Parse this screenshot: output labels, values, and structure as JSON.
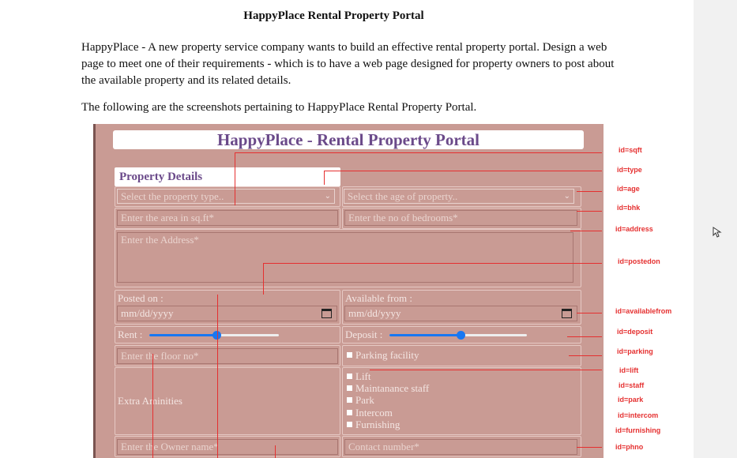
{
  "doc": {
    "title": "HappyPlace Rental Property Portal",
    "paragraph": "HappyPlace - A new property service company wants to build an effective rental property portal. Design a web page to meet one of their requirements - which is to have a web page designed for property owners to post about the available property and its related details.",
    "paragraph2": "The following are the screenshots pertaining to HappyPlace Rental Property Portal."
  },
  "portal": {
    "title": "HappyPlace - Rental Property Portal",
    "section": "Property Details",
    "type_placeholder": "Select the property type..",
    "age_placeholder": "Select the age of property..",
    "sqft_placeholder": "Enter the area in sq.ft*",
    "bhk_placeholder": "Enter the no of bedrooms*",
    "address_placeholder": "Enter the Address*",
    "posted_label": "Posted on :",
    "posted_value": "mm/dd/yyyy",
    "available_label": "Available from :",
    "available_value": "mm/dd/yyyy",
    "rent_label": "Rent :",
    "rent_level": 0.52,
    "deposit_label": "Deposit :",
    "deposit_level": 0.52,
    "floor_placeholder": "Enter the floor no*",
    "parking_label": "Parking facility",
    "amenities_label": "Extra Aminities",
    "amenities": [
      "Lift",
      "Maintanance staff",
      "Park",
      "Intercom",
      "Furnishing"
    ],
    "owner_placeholder": "Enter the Owner name*",
    "contact_placeholder": "Contact number*"
  },
  "annotations": {
    "sqft": "id=sqft",
    "type": "id=type",
    "age": "id=age",
    "bhk": "id=bhk",
    "address": "id=address",
    "postedon": "id=postedon",
    "availablefrom": "id=availablefrom",
    "deposit": "id=deposit",
    "parking": "id=parking",
    "lift": "id=lift",
    "staff": "id=staff",
    "park": "id=park",
    "intercom": "id=intercom",
    "furnishing": "id=furnishing",
    "phno": "id=phno"
  },
  "colors": {
    "panel": "#c99b94",
    "annotation": "#e53030",
    "title": "#6b4a8a",
    "slider": "#1877f2"
  }
}
